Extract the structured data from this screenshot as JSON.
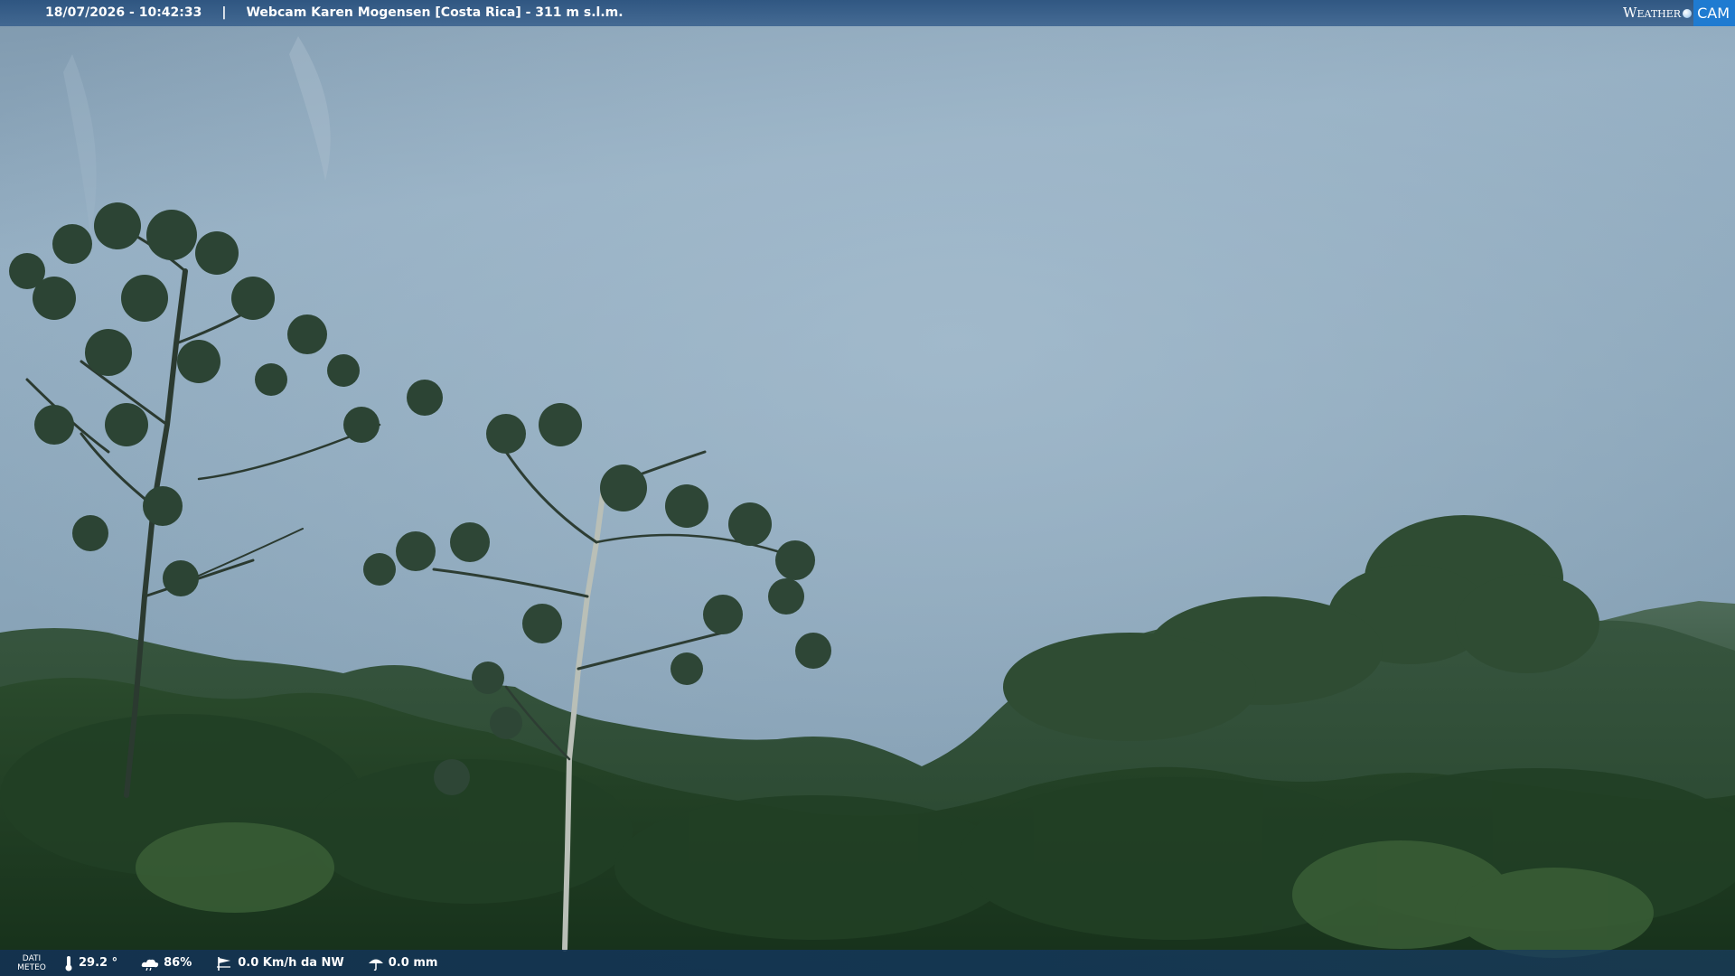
{
  "header": {
    "datetime": "18/07/2026 - 10:42:33",
    "separator": "|",
    "caption": "Webcam Karen Mogensen [Costa Rica]  - 311 m s.l.m.",
    "brand_left": "Weather",
    "brand_right": "CAM",
    "brand_color": "#1f7bd1"
  },
  "meteo": {
    "label_line1": "DATI",
    "label_line2": "METEO",
    "temperature": "29.2 °",
    "humidity": "86%",
    "wind": "0.0 Km/h da NW",
    "rain": "0.0 mm"
  },
  "scene": {
    "sky_color": "#8fa9bd",
    "forest_color": "#1e3a22"
  }
}
